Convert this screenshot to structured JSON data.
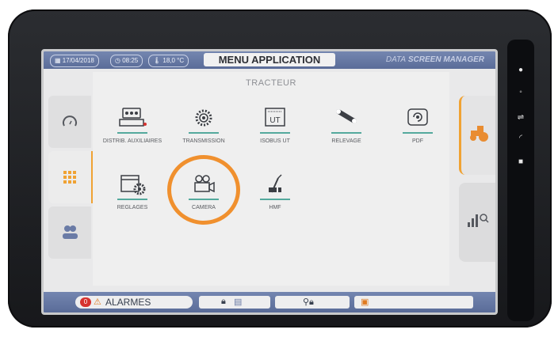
{
  "status": {
    "date": "17/04/2018",
    "time": "08:25",
    "temperature": "18,0 °C"
  },
  "header": {
    "title": "MENU APPLICATION",
    "brand_prefix": "DATA",
    "brand_bold": "SCREEN MANAGER"
  },
  "section": {
    "title": "TRACTEUR"
  },
  "apps": [
    {
      "label": "DISTRIB. AUXILIAIRES"
    },
    {
      "label": "TRANSMISSION"
    },
    {
      "label": "ISOBUS UT",
      "icon_text": "UT"
    },
    {
      "label": "RELEVAGE"
    },
    {
      "label": "PDF"
    },
    {
      "label": "REGLAGES"
    },
    {
      "label": "CAMERA"
    },
    {
      "label": "HMF"
    }
  ],
  "footer": {
    "alarm_count": "0",
    "alarms_label": "ALARMES"
  },
  "colors": {
    "accent": "#f0902e",
    "header_bar": "#6578a6",
    "underline": "#54a99d",
    "alarm": "#d6322f"
  }
}
